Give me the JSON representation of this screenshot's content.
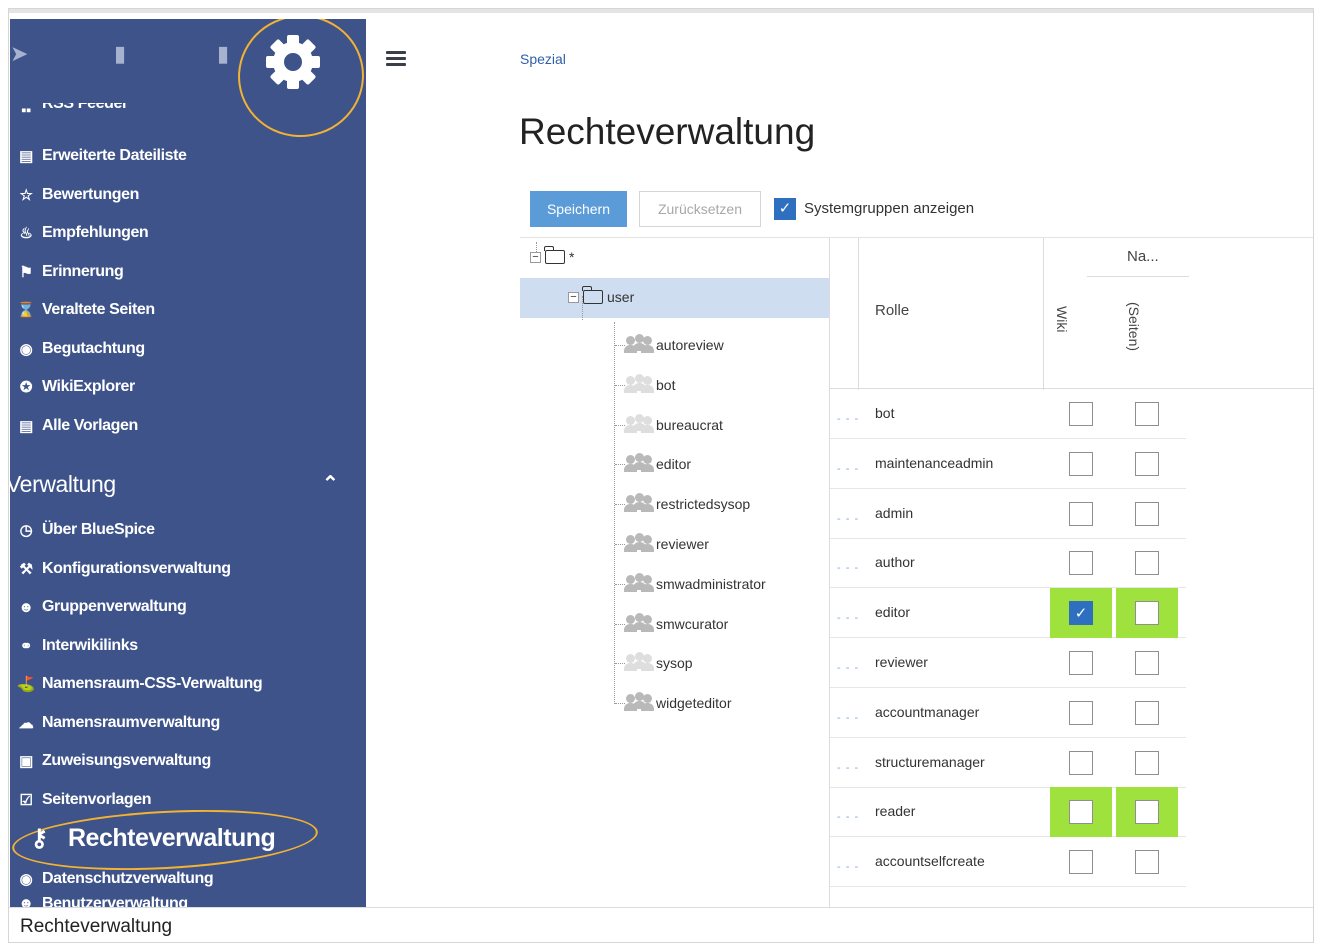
{
  "sidebar": {
    "partial_top_item": "RSS Feeder",
    "items": [
      {
        "icon": "list-icon",
        "glyph": "▤",
        "label": "Erweiterte Dateiliste"
      },
      {
        "icon": "star-icon",
        "glyph": "☆",
        "label": "Bewertungen"
      },
      {
        "icon": "flame-icon",
        "glyph": "♨",
        "label": "Empfehlungen"
      },
      {
        "icon": "flag-icon",
        "glyph": "⚑",
        "label": "Erinnerung"
      },
      {
        "icon": "hourglass-icon",
        "glyph": "⌛",
        "label": "Veraltete Seiten"
      },
      {
        "icon": "eye-icon",
        "glyph": "◉",
        "label": "Begutachtung"
      },
      {
        "icon": "compass-icon",
        "glyph": "✪",
        "label": "WikiExplorer"
      },
      {
        "icon": "list-icon",
        "glyph": "▤",
        "label": "Alle Vorlagen"
      }
    ],
    "section": {
      "title": "Verwaltung"
    },
    "admin_items": [
      {
        "icon": "gauge-icon",
        "glyph": "◷",
        "label": "Über BlueSpice"
      },
      {
        "icon": "wrench-icon",
        "glyph": "⚒",
        "label": "Konfigurationsverwaltung"
      },
      {
        "icon": "users-icon",
        "glyph": "☻",
        "label": "Gruppenverwaltung"
      },
      {
        "icon": "link-icon",
        "glyph": "⚭",
        "label": "Interwikilinks"
      },
      {
        "icon": "paint-roller-icon",
        "glyph": "⛳",
        "label": "Namensraum-CSS-Verwaltung"
      },
      {
        "icon": "cloud-icon",
        "glyph": "☁",
        "label": "Namensraumverwaltung"
      },
      {
        "icon": "assignment-icon",
        "glyph": "▣",
        "label": "Zuweisungsverwaltung"
      },
      {
        "icon": "template-icon",
        "glyph": "☑",
        "label": "Seitenvorlagen"
      }
    ],
    "highlighted": "Rechteverwaltung",
    "partial_bottom": [
      "Datenschutzverwaltung",
      "Benutzerverwaltung"
    ]
  },
  "breadcrumb": "Spezial",
  "page_title": "Rechteverwaltung",
  "toolbar": {
    "save_label": "Speichern",
    "reset_label": "Zurücksetzen",
    "system_groups_label": "Systemgruppen anzeigen",
    "system_groups_checked": true
  },
  "tree": {
    "root": "*",
    "user": "user",
    "groups": [
      {
        "name": "autoreview",
        "style": "dark"
      },
      {
        "name": "bot",
        "style": "light"
      },
      {
        "name": "bureaucrat",
        "style": "light"
      },
      {
        "name": "editor",
        "style": "dark"
      },
      {
        "name": "restrictedsysop",
        "style": "dark"
      },
      {
        "name": "reviewer",
        "style": "dark"
      },
      {
        "name": "smwadministrator",
        "style": "dark"
      },
      {
        "name": "smwcurator",
        "style": "dark"
      },
      {
        "name": "sysop",
        "style": "light"
      },
      {
        "name": "widgeteditor",
        "style": "dark"
      }
    ]
  },
  "grid": {
    "headers": {
      "role": "Rolle",
      "namespace": "Na...",
      "wiki": "Wiki",
      "pages": "(Seiten)"
    },
    "rows": [
      {
        "role": "bot",
        "wiki": false,
        "pages": false,
        "highlight": false
      },
      {
        "role": "maintenanceadmin",
        "wiki": false,
        "pages": false,
        "highlight": false
      },
      {
        "role": "admin",
        "wiki": false,
        "pages": false,
        "highlight": false
      },
      {
        "role": "author",
        "wiki": false,
        "pages": false,
        "highlight": false
      },
      {
        "role": "editor",
        "wiki": true,
        "pages": false,
        "highlight": true
      },
      {
        "role": "reviewer",
        "wiki": false,
        "pages": false,
        "highlight": false
      },
      {
        "role": "accountmanager",
        "wiki": false,
        "pages": false,
        "highlight": false
      },
      {
        "role": "structuremanager",
        "wiki": false,
        "pages": false,
        "highlight": false
      },
      {
        "role": "reader",
        "wiki": false,
        "pages": false,
        "highlight": true
      },
      {
        "role": "accountselfcreate",
        "wiki": false,
        "pages": false,
        "highlight": false
      }
    ],
    "highlight_color": "#9fe23d",
    "check_color": "#2f6fc0"
  },
  "caption": "Rechteverwaltung",
  "colors": {
    "sidebar": "#3e5389",
    "annotation": "#f2b233",
    "link": "#2f5fa8"
  }
}
